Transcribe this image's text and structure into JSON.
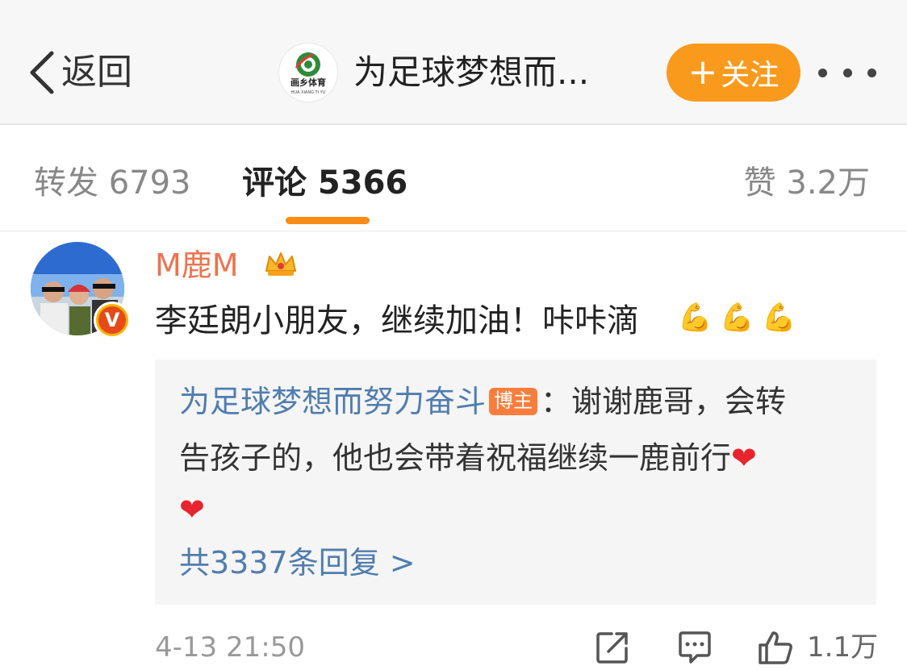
{
  "nav": {
    "back_label": "返回",
    "title": "为足球梦想而...",
    "logo_text": "画乡体育",
    "logo_subtext": "HUA XIANG TI YU",
    "follow_label": "关注",
    "follow_plus": "+"
  },
  "tabs": {
    "repost": "转发 6793",
    "comment": "评论 5366",
    "like": "赞 3.2万",
    "active": "comment"
  },
  "comment": {
    "user_name": "M鹿M",
    "text": "李廷朗小朋友，继续加油！咔咔滴",
    "emojis": [
      "💪",
      "💪",
      "💪"
    ],
    "verified_mark": "V",
    "reply": {
      "author": "为足球梦想而努力奋斗",
      "badge": "博主",
      "line1_text": "：谢谢鹿哥，会转",
      "line2_text": "告孩子的，他也会带着祝福继续一鹿前行",
      "heart": "❤",
      "total": "共3337条回复 >"
    },
    "timestamp": "4-13 21:50",
    "like_count": "1.1万"
  },
  "colors": {
    "accent": "#fa9a1d",
    "username": "#eb7350",
    "link": "#507daf"
  },
  "icons": [
    "back-chevron-icon",
    "more-dots-icon",
    "crown-icon",
    "verified-icon",
    "share-icon",
    "comment-icon",
    "thumbs-up-icon"
  ]
}
